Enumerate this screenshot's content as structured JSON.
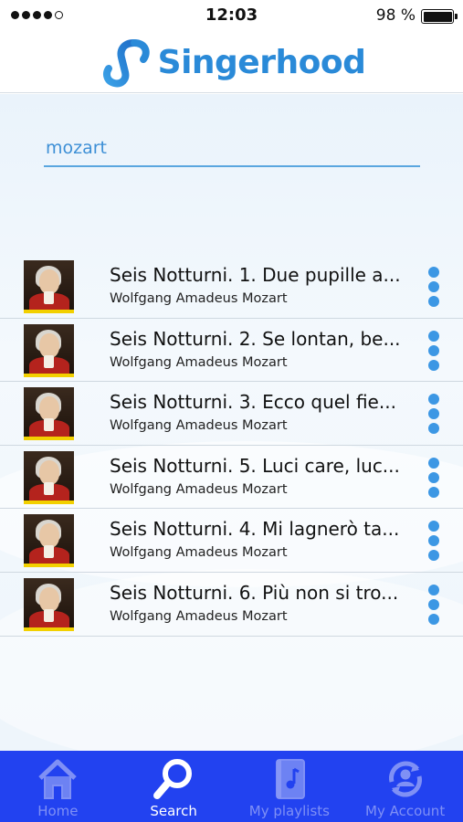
{
  "status_bar": {
    "time": "12:03",
    "battery_text": "98 %",
    "signal_bars": 5,
    "signal_filled": 4
  },
  "header": {
    "brand": "Singerhood",
    "logo_icon": "singerhood-logo-icon"
  },
  "search": {
    "value": "mozart",
    "placeholder": ""
  },
  "results": [
    {
      "title": "Seis Notturni. 1. Due pupille a...",
      "artist": "Wolfgang Amadeus Mozart"
    },
    {
      "title": "Seis Notturni. 2. Se lontan, be...",
      "artist": "Wolfgang Amadeus Mozart"
    },
    {
      "title": "Seis Notturni. 3. Ecco quel fie...",
      "artist": "Wolfgang Amadeus Mozart"
    },
    {
      "title": "Seis Notturni. 5. Luci care, luc...",
      "artist": "Wolfgang Amadeus Mozart"
    },
    {
      "title": "Seis Notturni. 4. Mi lagnerò ta...",
      "artist": "Wolfgang Amadeus Mozart"
    },
    {
      "title": "Seis Notturni. 6. Più non si tro...",
      "artist": "Wolfgang Amadeus Mozart"
    }
  ],
  "tabbar": {
    "tabs": [
      {
        "label": "Home",
        "icon": "home-icon",
        "active": false
      },
      {
        "label": "Search",
        "icon": "search-icon",
        "active": true
      },
      {
        "label": "My playlists",
        "icon": "playlist-book-icon",
        "active": false
      },
      {
        "label": "My Account",
        "icon": "account-refresh-icon",
        "active": false
      }
    ]
  },
  "colors": {
    "brand_blue": "#2a8ad8",
    "tabbar_bg": "#2242f0",
    "menu_dot": "#3c97e4",
    "tab_inactive": "#7f90f5"
  }
}
